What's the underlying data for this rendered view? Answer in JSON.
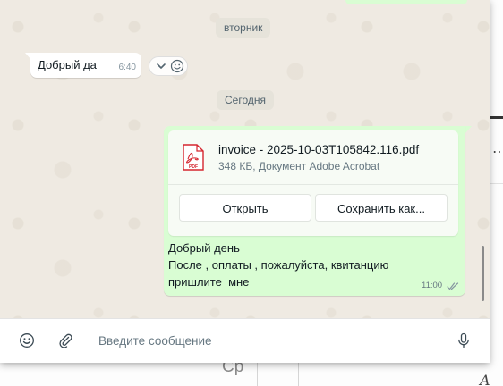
{
  "background_app": {
    "partial_text": "Ср",
    "corner_glyph": "A"
  },
  "chat": {
    "date_separators": {
      "previous": "вторник",
      "today": "Сегодня"
    },
    "incoming_message": {
      "text": "Добрый да",
      "time": "6:40"
    },
    "reaction_bar": {
      "icons": [
        "chevron-down-icon",
        "emoji-icon"
      ]
    },
    "outgoing_message": {
      "document": {
        "icon": "pdf-icon",
        "icon_label": "PDF",
        "file_name": "invoice - 2025-10-03T105842.116.pdf",
        "meta": "348 КБ, Документ Adobe Acrobat",
        "open_label": "Открыть",
        "save_label": "Сохранить как..."
      },
      "caption_line1": "Добрый день",
      "caption_line2": "После , оплаты , пожалуйста, квитанцию",
      "caption_line3": "пришлите  мне",
      "time": "11:00",
      "status": "delivered"
    }
  },
  "compose": {
    "placeholder": "Введите сообщение",
    "icons": [
      "emoji-icon",
      "paperclip-icon",
      "microphone-icon"
    ]
  },
  "colors": {
    "chat_background": "#efeae2",
    "outgoing_bubble": "#d9fdd3",
    "incoming_bubble": "#ffffff",
    "pdf_red": "#d5262f"
  }
}
